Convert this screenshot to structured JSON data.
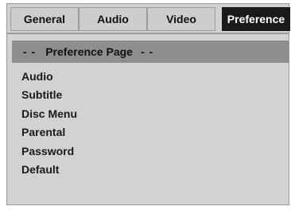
{
  "tabs": [
    {
      "label": "General"
    },
    {
      "label": "Audio"
    },
    {
      "label": "Video"
    },
    {
      "label": "Preference"
    }
  ],
  "page_header": {
    "prefix": "- -",
    "title": "Preference Page",
    "suffix": "- -"
  },
  "items": [
    {
      "label": "Audio"
    },
    {
      "label": "Subtitle"
    },
    {
      "label": "Disc Menu"
    },
    {
      "label": "Parental"
    },
    {
      "label": "Password"
    },
    {
      "label": "Default"
    }
  ],
  "colors": {
    "active_tab": "#1a1a1a",
    "header_bar": "#8e8e8e",
    "panel": "#d2d2d2"
  }
}
